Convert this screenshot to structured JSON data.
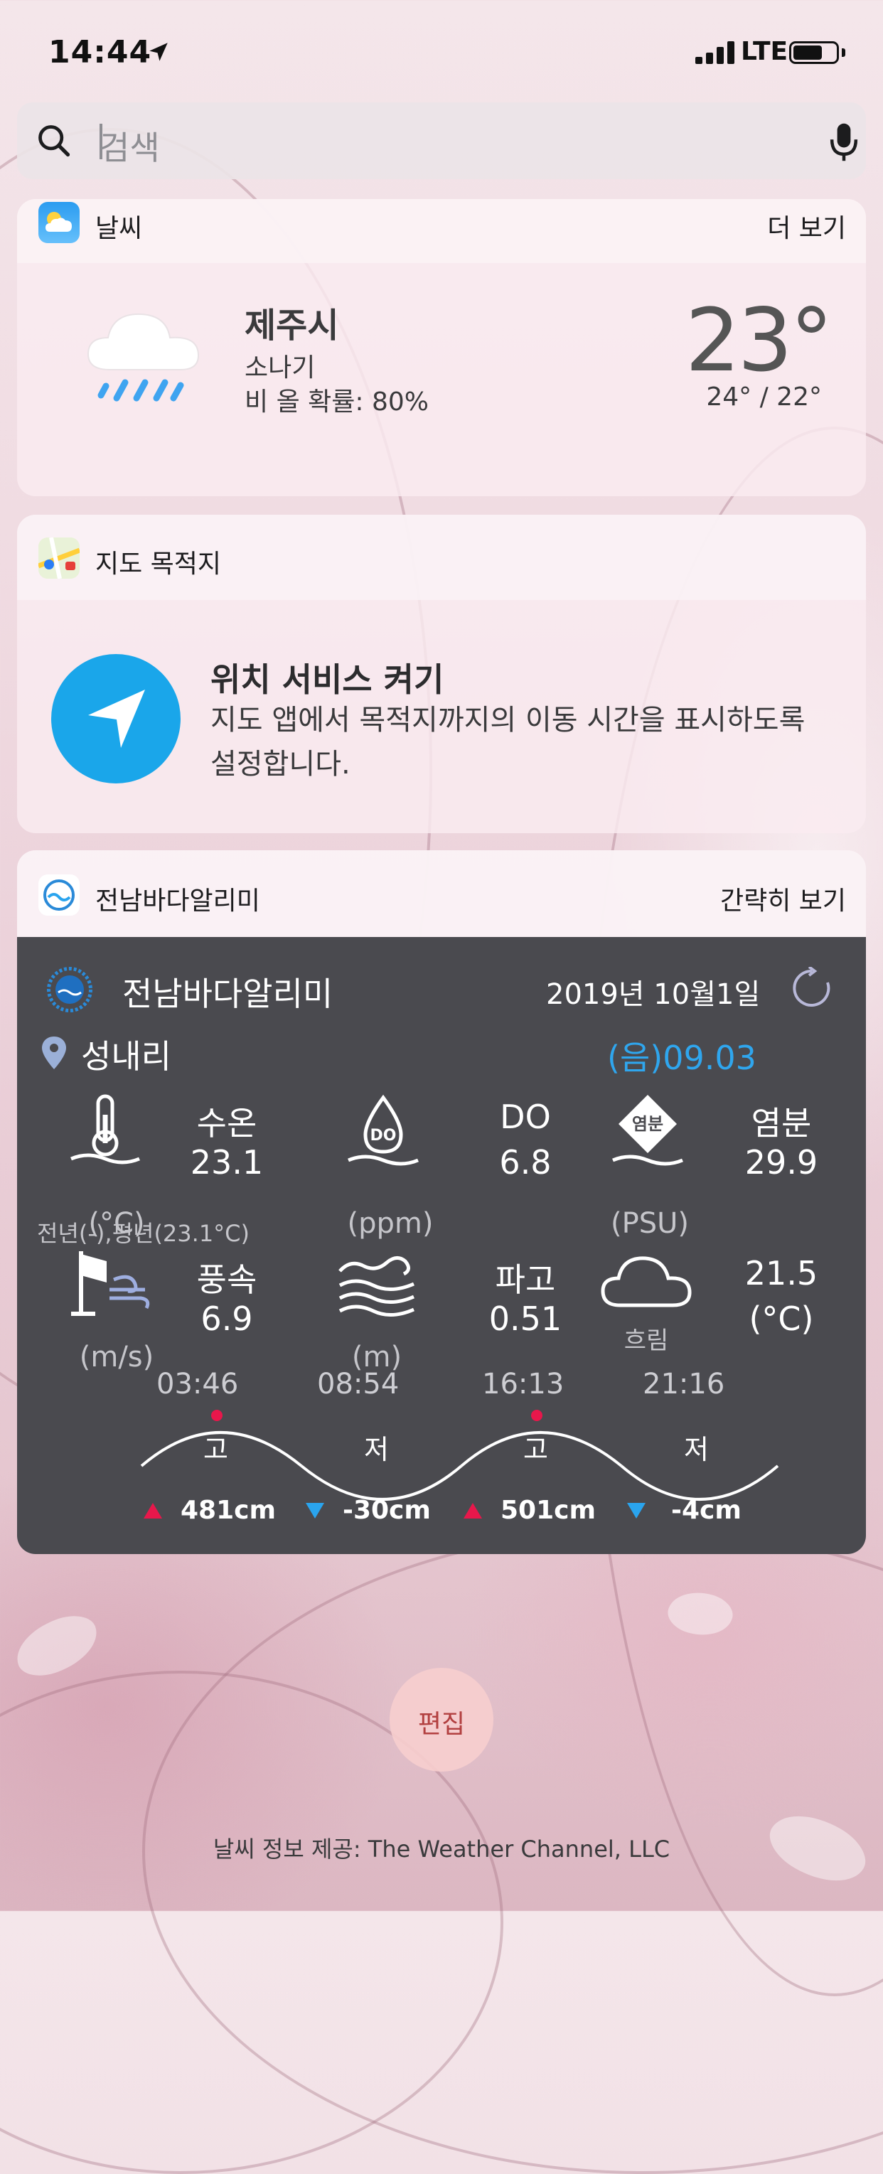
{
  "status_bar": {
    "time": "14:44",
    "network": "LTE"
  },
  "search": {
    "placeholder": "검색"
  },
  "weather_widget": {
    "title": "날씨",
    "action": "더 보기",
    "city": "제주시",
    "condition": "소나기",
    "rain_chance": "비 올 확률: 80%",
    "temperature": "23°",
    "high_low": "24° / 22°"
  },
  "maps_widget": {
    "title": "지도 목적지",
    "heading": "위치 서비스 켜기",
    "body": "지도 앱에서 목적지까지의 이동 시간을 표시하도록 설정합니다."
  },
  "sea_widget": {
    "title": "전남바다알리미",
    "action": "간략히 보기",
    "app_name": "전남바다알리미",
    "date": "2019년 10월1일",
    "place": "성내리",
    "lunar": "(음)09.03",
    "metrics": {
      "water_temp": {
        "label": "수온",
        "value": "23.1",
        "unit": "(°C)"
      },
      "do": {
        "label": "DO",
        "value": "6.8",
        "unit": "(ppm)"
      },
      "salinity": {
        "label": "염분",
        "value": "29.9",
        "unit": "(PSU)",
        "icon_text": "염분"
      },
      "wind": {
        "label": "풍속",
        "value": "6.9",
        "unit": "(m/s)"
      },
      "wave": {
        "label": "파고",
        "value": "0.51",
        "unit": "(m)"
      },
      "weather": {
        "label": "흐림",
        "value": "21.5",
        "unit": "(°C)"
      },
      "do_icon_text": "DO",
      "temp_note": "전년(-),평년(23.1°C)"
    },
    "tides": [
      {
        "time": "03:46",
        "type": "고",
        "value": "481cm"
      },
      {
        "time": "08:54",
        "type": "저",
        "value": "-30cm"
      },
      {
        "time": "16:13",
        "type": "고",
        "value": "501cm"
      },
      {
        "time": "21:16",
        "type": "저",
        "value": "-4cm"
      }
    ],
    "colors": {
      "high": "#e8174b",
      "low": "#2aa4ee",
      "panel": "#4a4a4f"
    }
  },
  "edit_button": {
    "label": "편집"
  },
  "footer": {
    "label": "날씨 정보 제공: The Weather Channel, LLC"
  }
}
